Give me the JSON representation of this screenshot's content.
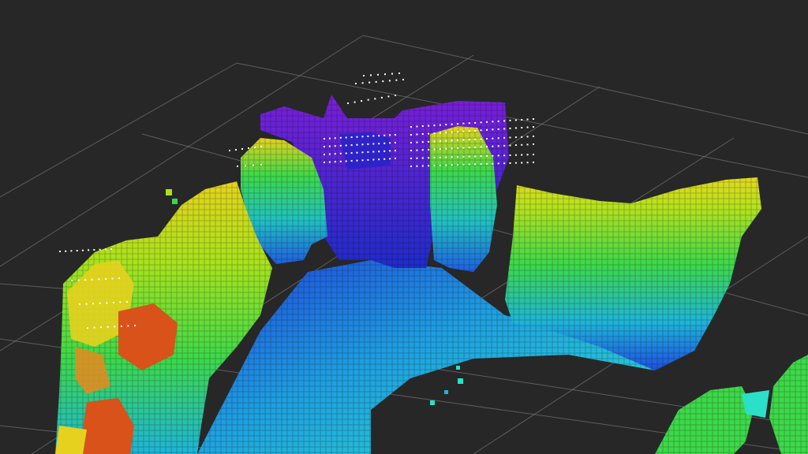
{
  "viewer": {
    "background_color": "#272727",
    "grid_color": "#8a8a8a",
    "scan_point_color": "#ffffff",
    "voxel_colormap": [
      "#7a1fd6",
      "#2a24c8",
      "#1f5fe0",
      "#19b4e0",
      "#2be0c8",
      "#39d84a",
      "#a8e21e",
      "#e6d21e",
      "#e88a1e",
      "#d8521a"
    ]
  },
  "voxel_map": {
    "regions": [
      "left-wall",
      "left-column",
      "back-opening",
      "back-right-wall",
      "right-wall",
      "floor",
      "foreground-right-clusters"
    ]
  }
}
